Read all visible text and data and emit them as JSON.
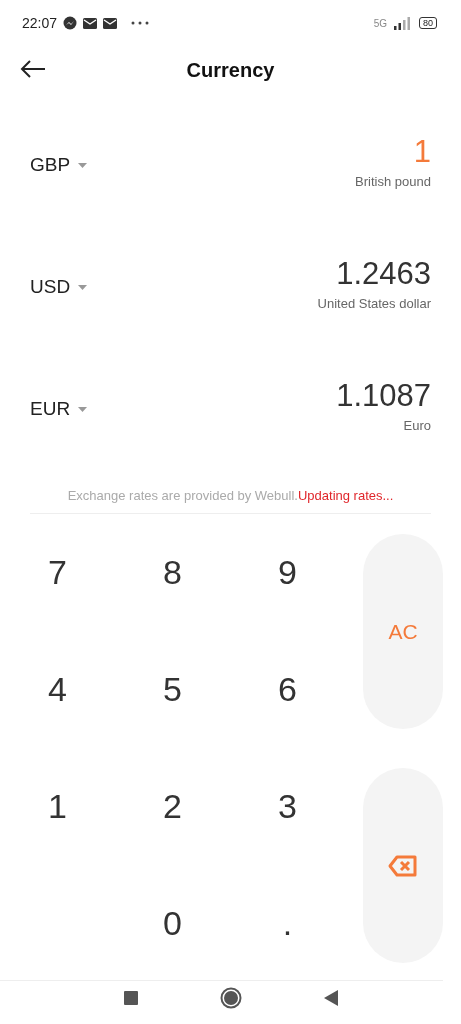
{
  "status_bar": {
    "time": "22:07",
    "network": "5G",
    "battery": "80"
  },
  "header": {
    "title": "Currency"
  },
  "currencies": [
    {
      "code": "GBP",
      "value": "1",
      "name": "British pound",
      "selected": true
    },
    {
      "code": "USD",
      "value": "1.2463",
      "name": "United States dollar",
      "selected": false
    },
    {
      "code": "EUR",
      "value": "1.1087",
      "name": "Euro",
      "selected": false
    }
  ],
  "note": {
    "text": "Exchange rates are provided by Webull.",
    "status": "Updating rates..."
  },
  "keypad": {
    "rows": [
      [
        "7",
        "8",
        "9"
      ],
      [
        "4",
        "5",
        "6"
      ],
      [
        "1",
        "2",
        "3"
      ],
      [
        null,
        "0",
        "."
      ]
    ],
    "clear": "AC"
  }
}
